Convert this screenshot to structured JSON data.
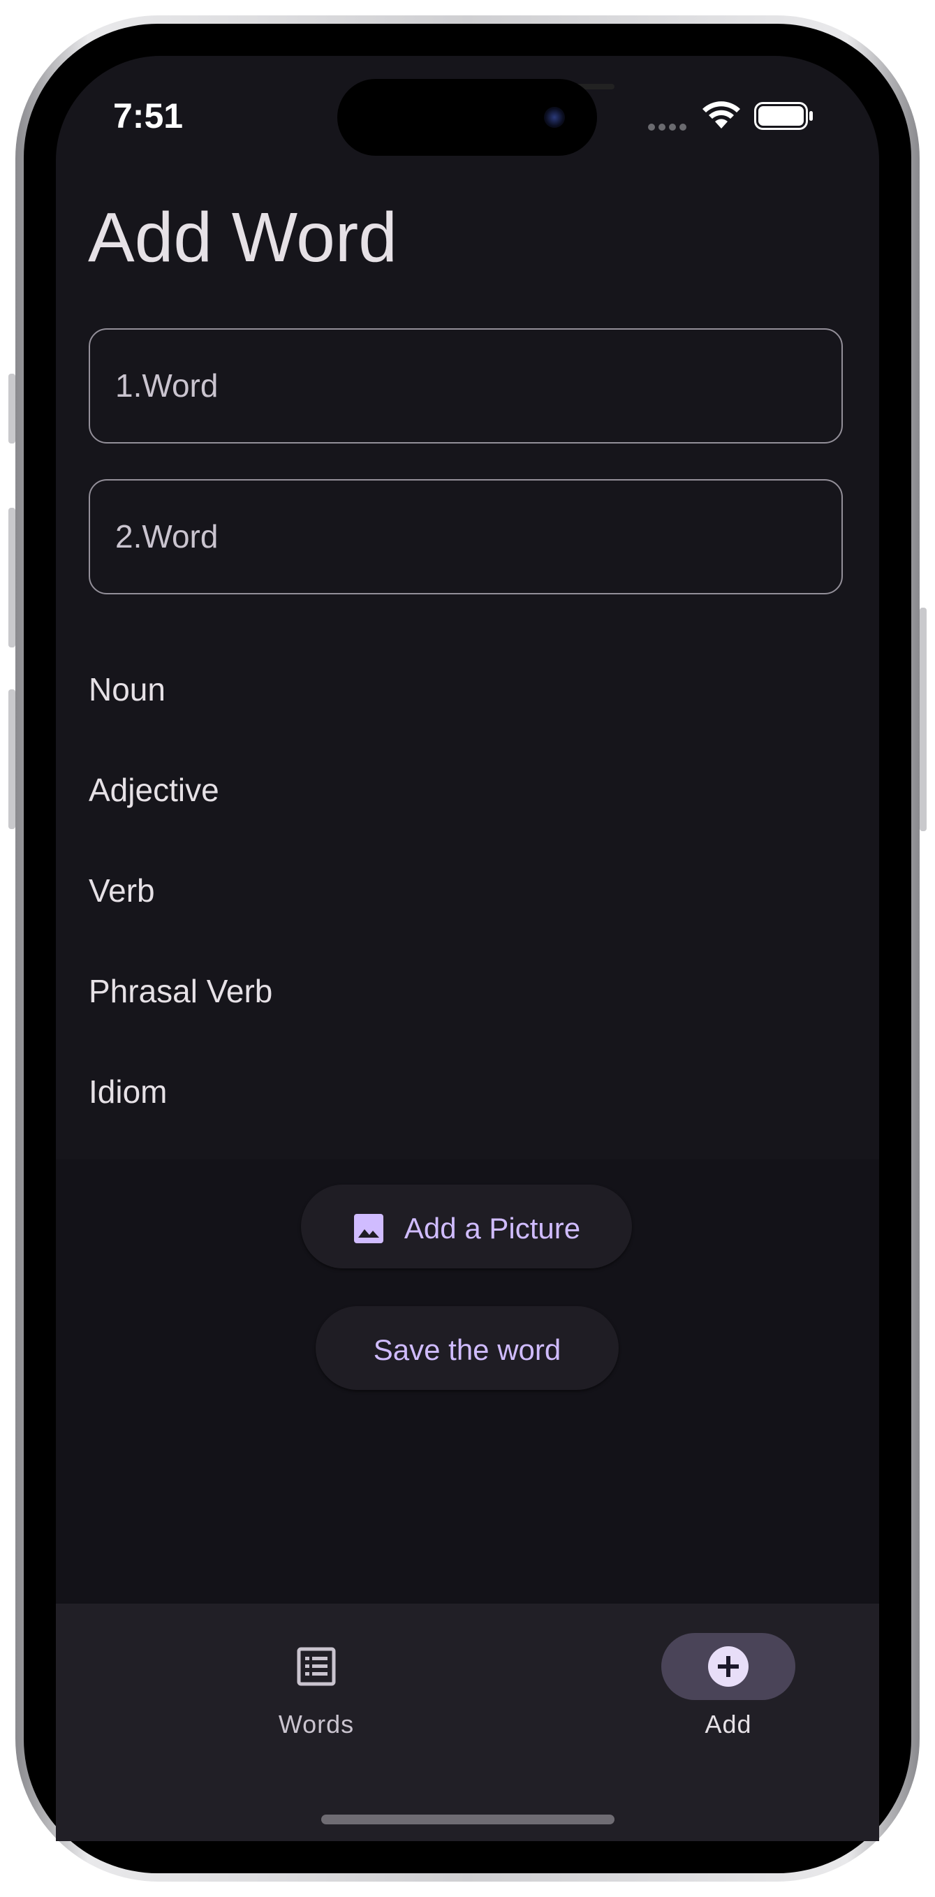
{
  "status_bar": {
    "time": "7:51"
  },
  "page": {
    "title": "Add Word"
  },
  "fields": [
    {
      "placeholder": "1.Word"
    },
    {
      "placeholder": "2.Word"
    }
  ],
  "word_types": [
    "Noun",
    "Adjective",
    "Verb",
    "Phrasal Verb",
    "Idiom"
  ],
  "actions": {
    "add_picture_label": "Add a Picture",
    "save_label": "Save the word"
  },
  "nav": {
    "items": [
      {
        "label": "Words",
        "icon": "list-icon",
        "selected": false
      },
      {
        "label": "Add",
        "icon": "add-circle-icon",
        "selected": true
      }
    ]
  },
  "colors": {
    "background": "#16151b",
    "accent": "#d0bcff",
    "nav_background": "#211f26",
    "nav_indicator": "#4a4458",
    "text_primary": "#e6e1e6"
  }
}
